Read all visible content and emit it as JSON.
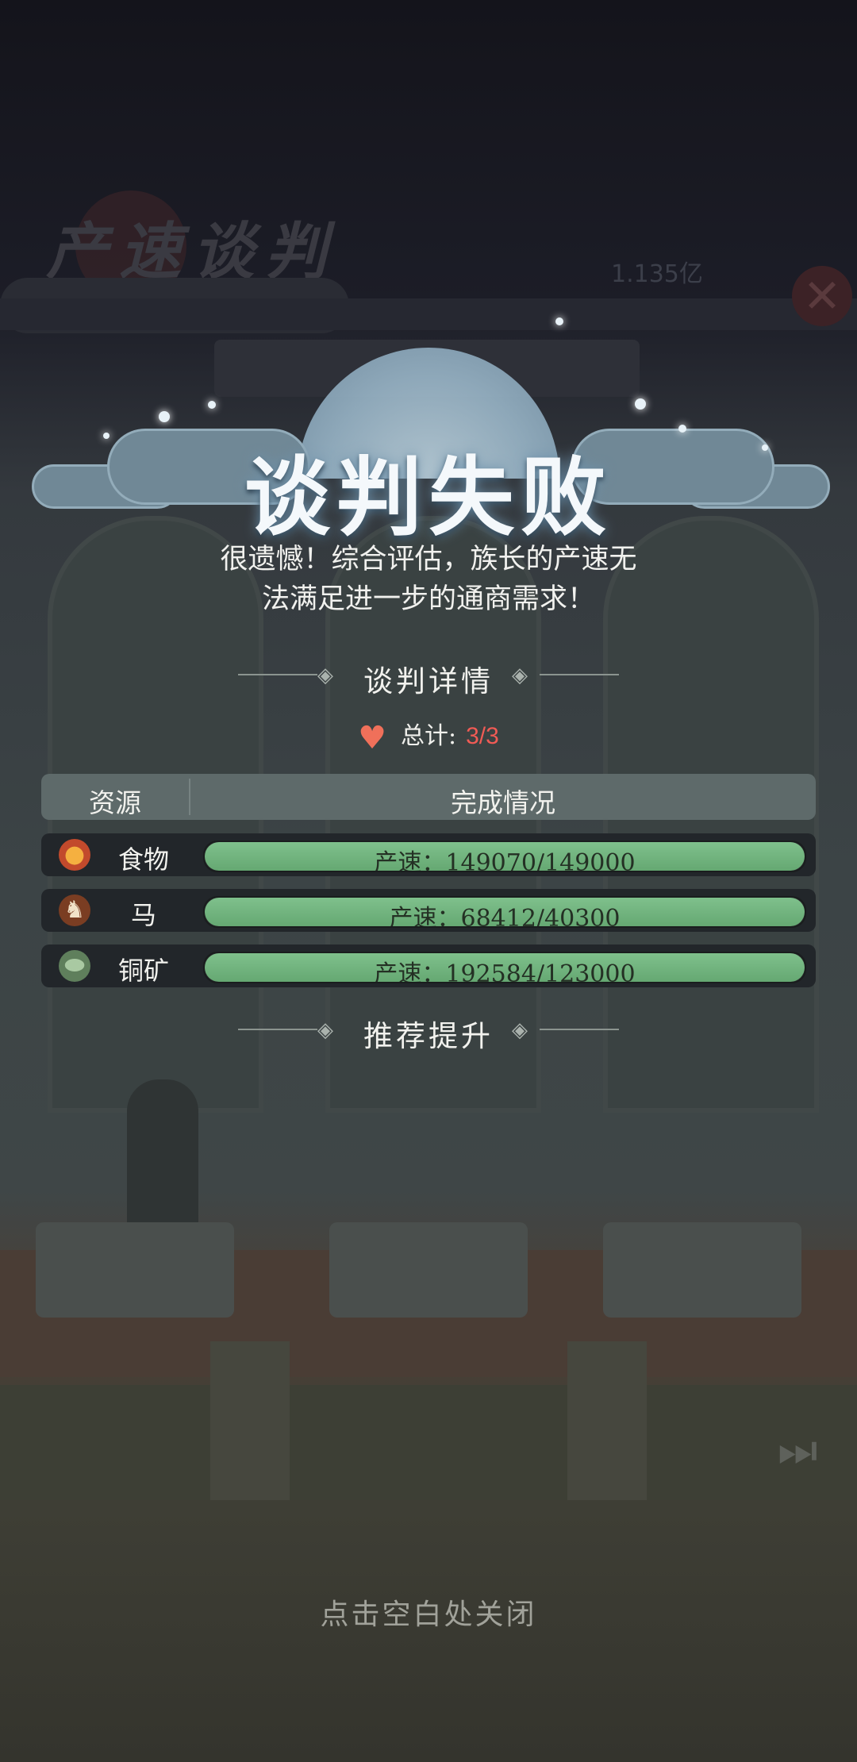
{
  "background": {
    "title": "产速谈判",
    "currency": "1.135亿"
  },
  "header": {
    "title": "谈判失败"
  },
  "message": {
    "line1": "很遗憾！综合评估，族长的产速无",
    "line2": "法满足进一步的通商需求！"
  },
  "details": {
    "heading": "谈判详情",
    "total_label": "总计:",
    "total_value": "3/3",
    "heart_color": "#f0705a"
  },
  "table": {
    "col_resource": "资源",
    "col_status": "完成情况",
    "rows": [
      {
        "icon": "food-icon",
        "name": "食物",
        "text": "产速：149070/149000",
        "progress": 1.0
      },
      {
        "icon": "horse-icon",
        "name": "马",
        "text": "产速：68412/40300",
        "progress": 1.0
      },
      {
        "icon": "copper-ore-icon",
        "name": "铜矿",
        "text": "产速：192584/123000",
        "progress": 1.0
      }
    ],
    "bar_color": "#6fb47c"
  },
  "recommend": {
    "heading": "推荐提升"
  },
  "footer": {
    "close_hint": "点击空白处关闭"
  }
}
